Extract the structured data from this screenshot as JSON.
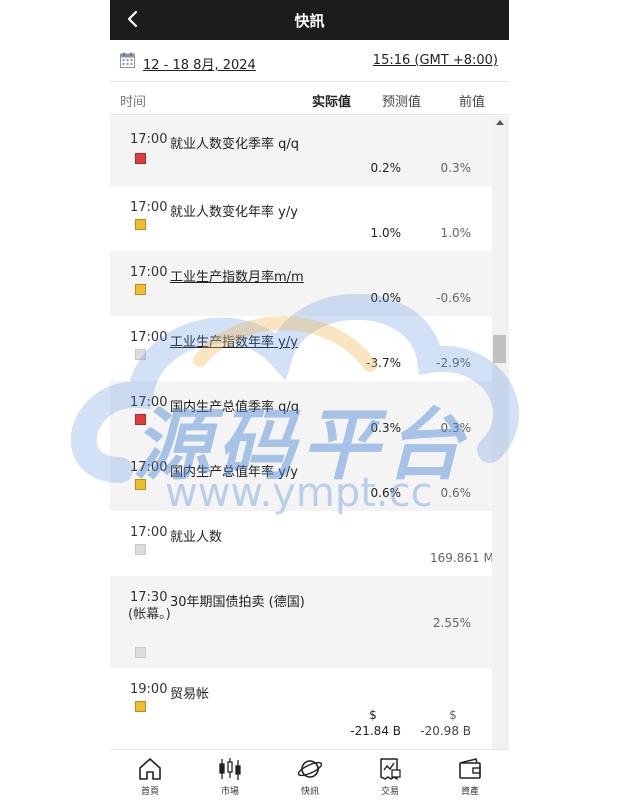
{
  "header": {
    "title": "快訊"
  },
  "datebar": {
    "date_range": "12 - 18 8月, 2024",
    "time_zone": "15:16 (GMT +8:00)"
  },
  "columns": {
    "time": "时间",
    "actual": "实际值",
    "forecast": "预测值",
    "previous": "前值"
  },
  "events": [
    {
      "time": "17:00",
      "name": "就业人数变化季率 q/q",
      "impact": "high",
      "actual": "0.2%",
      "forecast": "0.3%"
    },
    {
      "time": "17:00",
      "name": "就业人数变化年率 y/y",
      "impact": "medium",
      "actual": "1.0%",
      "forecast": "1.0%"
    },
    {
      "time": "17:00",
      "name": "工业生产指数月率m/m",
      "impact": "medium",
      "actual": "0.0%",
      "forecast": "-0.6%"
    },
    {
      "time": "17:00",
      "name": "工业生产指数年率 y/y",
      "impact": "low",
      "actual": "-3.7%",
      "forecast": "-2.9%"
    },
    {
      "time": "17:00",
      "name": "国内生产总值季率 q/q",
      "impact": "high",
      "actual": "0.3%",
      "forecast": "0.3%"
    },
    {
      "time": "17:00",
      "name": "国内生产总值年率 y/y",
      "impact": "medium",
      "actual": "0.6%",
      "forecast": "0.6%"
    },
    {
      "time": "17:00",
      "name": "就业人数",
      "impact": "low",
      "actual": "",
      "forecast": "169.861 M"
    },
    {
      "time": "17:30",
      "time_note": "(帐幕。)",
      "name": "30年期国债拍卖 (德国)",
      "impact": "low",
      "actual": "",
      "forecast": "2.55%"
    },
    {
      "time": "19:00",
      "name": "贸易帐",
      "impact": "medium",
      "actual_currency": "$",
      "actual": "-21.84 B",
      "forecast_currency": "$",
      "forecast": "-20.98 B"
    }
  ],
  "watermark": {
    "text": "源码平台",
    "url": "www.ympt.cc"
  },
  "bottom_nav": [
    {
      "label": "首頁",
      "icon": "home-icon"
    },
    {
      "label": "市場",
      "icon": "candlestick-icon"
    },
    {
      "label": "快訊",
      "icon": "planet-icon"
    },
    {
      "label": "交易",
      "icon": "trade-receipt-icon"
    },
    {
      "label": "資產",
      "icon": "wallet-icon"
    }
  ],
  "colors": {
    "header_bg": "#1c1c1c",
    "impact_high": "#e03c3c",
    "impact_medium": "#f2bd2c",
    "impact_low": "#dcdcdc"
  }
}
